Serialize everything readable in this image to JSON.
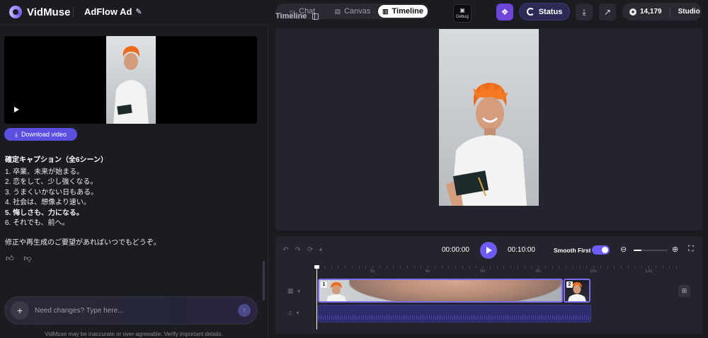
{
  "app": {
    "name": "VidMuse",
    "project_title": "AdFlow Ad"
  },
  "tabs": [
    {
      "label": "Chat",
      "icon": "chat-icon"
    },
    {
      "label": "Canvas",
      "icon": "canvas-icon"
    },
    {
      "label": "Timeline",
      "icon": "timeline-icon",
      "active": true
    }
  ],
  "header": {
    "debug_label": "Debug",
    "status_label": "Status",
    "credits": "14,179",
    "plan": "Studio"
  },
  "chat": {
    "download_label": "Download video",
    "caption_title": "確定キャプション（全6シーン）",
    "captions": [
      "1. 卒業、未来が始まる。",
      "2. 恋をして、少し強くなる。",
      "3. うまくいかない日もある。",
      "4. 社会は、想像より速い。",
      "5. 悔しさも、力になる。",
      "6. それでも、前へ。"
    ],
    "note": "修正や再生成のご要望があればいつでもどうぞ。",
    "input_placeholder": "Need changes? Type here...",
    "disclaimer": "VidMuse may be inaccurate or over-agreeable. Verify important details."
  },
  "timeline": {
    "title": "Timeline",
    "current_time": "00:00:00",
    "total_time": "00:10:00",
    "smooth_first_label": "Smooth First",
    "smooth_first_on": true,
    "ruler_labels": [
      "2s",
      "4s",
      "6s",
      "8s",
      "10s",
      "12s"
    ],
    "clips": [
      {
        "number": "1"
      },
      {
        "number": "2"
      }
    ]
  },
  "colors": {
    "accent": "#6d5bf5",
    "background": "#1b1b22",
    "panel": "#24242d"
  }
}
